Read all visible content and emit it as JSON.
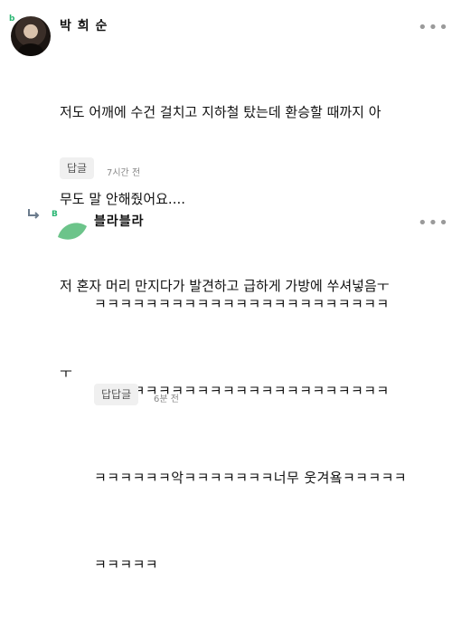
{
  "comments": [
    {
      "author": "박 희 순",
      "badge": "b",
      "lines": [
        "저도 어깨에 수건 걸치고 지하철 탔는데 환승할 때까지 아",
        "무도 말 안해줬어요....",
        "저 혼자 머리 만지다가 발견하고 급하게 가방에 쑤셔넣음ㅜ",
        "ㅜ"
      ],
      "reply_label": "답글",
      "time": "7시간 전",
      "more": "•••",
      "avatar_icon": "profile-photo"
    },
    {
      "author": "블라블라",
      "badge": "B",
      "lines": [
        "ㅋㅋㅋㅋㅋㅋㅋㅋㅋㅋㅋㅋㅋㅋㅋㅋㅋㅋㅋㅋㅋㅋㅋ",
        "ㅋㅋㅋㅋㅋㅋㅋㅋㅋㅋㅋㅋㅋㅋㅋㅋㅋㅋㅋㅋㅋㅋㅋ",
        "ㅋㅋㅋㅋㅋㅋ악ㅋㅋㅋㅋㅋㅋㅋ너무 웃겨욬ㅋㅋㅋㅋㅋ",
        "ㅋㅋㅋㅋㅋ"
      ],
      "reply_label": "답답글",
      "time": "6분 전",
      "more": "•••",
      "avatar_icon": "leaf-icon",
      "reply_icon": "reply-arrow-icon"
    }
  ],
  "colors": {
    "leaf": "#6cc48a",
    "badge": "#2bb673",
    "reply_bg": "#f0f0f0"
  }
}
